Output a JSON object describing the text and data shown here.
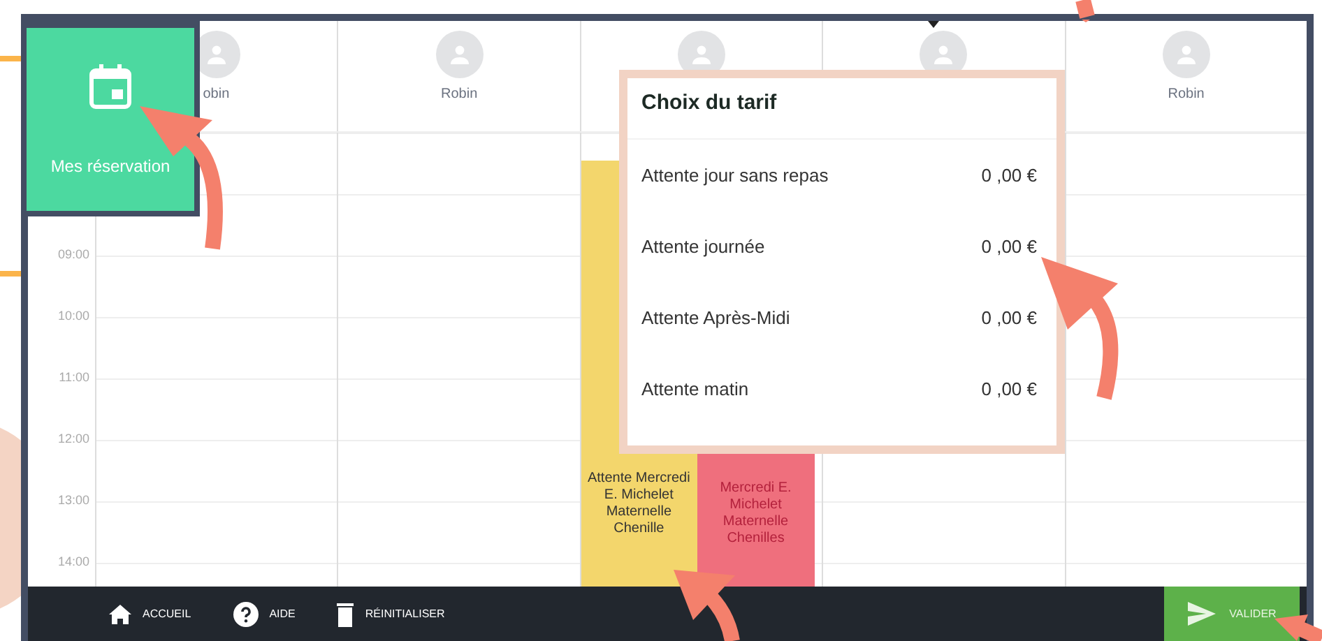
{
  "shortcut_tile": {
    "label": "Mes réservation"
  },
  "columns": [
    {
      "name": "obin"
    },
    {
      "name": "Robin"
    },
    {},
    {},
    {
      "name": "Robin"
    }
  ],
  "hours": [
    "09:00",
    "10:00",
    "11:00",
    "12:00",
    "13:00",
    "14:00"
  ],
  "events": [
    {
      "kind": "waiting",
      "color": "#f3d66c",
      "text": "Attente Mercredi E. Michelet Maternelle Chenille"
    },
    {
      "kind": "booked",
      "color": "#ef6f7d",
      "text": "Mercredi E. Michelet Maternelle Chenilles"
    }
  ],
  "tariff_popup": {
    "title": "Choix du tarif",
    "rows": [
      {
        "label": "Attente jour sans repas",
        "price": "0 ,00 €"
      },
      {
        "label": "Attente journée",
        "price": "0 ,00 €"
      },
      {
        "label": "Attente Après-Midi",
        "price": "0 ,00 €"
      },
      {
        "label": "Attente matin",
        "price": "0 ,00 €"
      }
    ]
  },
  "toolbar": {
    "items": [
      {
        "kind": "home",
        "label": "ACCUEIL"
      },
      {
        "kind": "help",
        "label": "AIDE"
      },
      {
        "kind": "trash",
        "label": "RÉINITIALISER"
      }
    ],
    "submit": "VALIDER"
  }
}
